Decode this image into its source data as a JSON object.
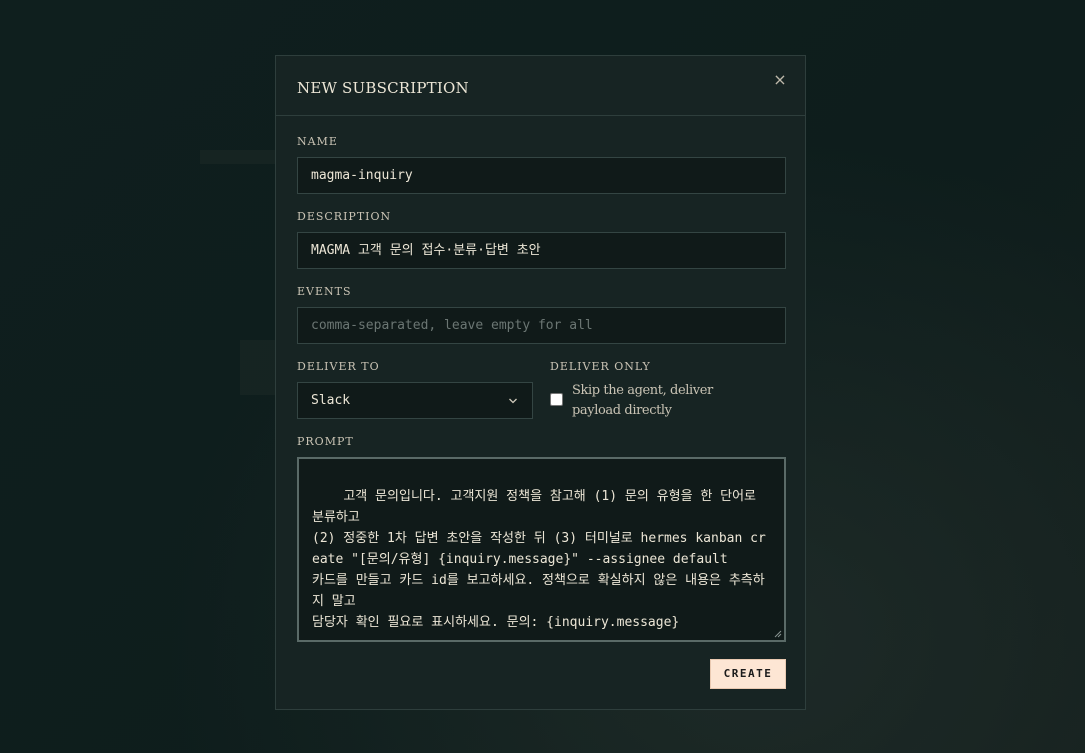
{
  "modal": {
    "title": "NEW SUBSCRIPTION",
    "close_label": "×"
  },
  "form": {
    "name": {
      "label": "NAME",
      "value": "magma-inquiry"
    },
    "description": {
      "label": "DESCRIPTION",
      "value": "MAGMA 고객 문의 접수·분류·답변 초안"
    },
    "events": {
      "label": "EVENTS",
      "value": "",
      "placeholder": "comma-separated, leave empty for all"
    },
    "deliver_to": {
      "label": "DELIVER TO",
      "selected": "Slack"
    },
    "deliver_only": {
      "label": "DELIVER ONLY",
      "checkbox_label": "Skip the agent, deliver payload directly",
      "checked": false
    },
    "prompt": {
      "label": "PROMPT",
      "value": "고객 문의입니다. 고객지원 정책을 참고해 (1) 문의 유형을 한 단어로 분류하고\n(2) 정중한 1차 답변 초안을 작성한 뒤 (3) 터미널로 hermes kanban create \"[문의/유형] {inquiry.message}\" --assignee default\n카드를 만들고 카드 id를 보고하세요. 정책으로 확실하지 않은 내용은 추측하지 말고\n담당자 확인 필요로 표시하세요. 문의: {inquiry.message}"
    },
    "submit_label": "CREATE"
  },
  "icons": {
    "close": "close-icon",
    "select_arrow": "chevron-down-icon",
    "resize": "resize-handle-icon"
  },
  "colors": {
    "page_background": "#0e1d1c",
    "modal_background": "#172423",
    "accent_button": "#fde6d4"
  }
}
